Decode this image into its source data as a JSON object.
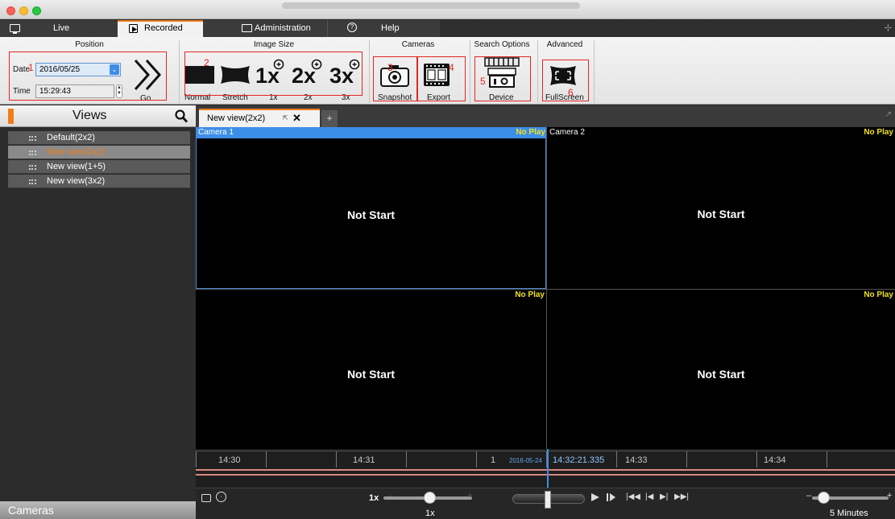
{
  "main_tabs": [
    {
      "label": "Live",
      "icon": "monitor-icon",
      "active": false
    },
    {
      "label": "Recorded",
      "icon": "play-icon",
      "active": true
    },
    {
      "label": "Administration",
      "icon": "window-icon",
      "active": false
    },
    {
      "label": "Help",
      "icon": "help-icon",
      "active": false
    }
  ],
  "ribbon": {
    "position": {
      "title": "Position",
      "date_label": "Date",
      "date_value": "2016/05/25",
      "time_label": "Time",
      "time_value": "15:29:43",
      "go_label": "Go"
    },
    "image_size": {
      "title": "Image Size",
      "buttons": [
        "Normal",
        "Stretch",
        "1x",
        "2x",
        "3x"
      ],
      "glyphs": [
        "1x",
        "2x",
        "3x"
      ]
    },
    "cameras": {
      "title": "Cameras",
      "buttons": [
        "Snapshot",
        "Export"
      ]
    },
    "search_options": {
      "title": "Search Options",
      "buttons": [
        "Device"
      ]
    },
    "advanced": {
      "title": "Advanced",
      "buttons": [
        "FullScreen"
      ]
    },
    "annotations": [
      "1",
      "2",
      "3",
      "4",
      "5",
      "6"
    ]
  },
  "views_panel": {
    "title": "Views",
    "items": [
      {
        "label": "Default(2x2)",
        "selected": false
      },
      {
        "label": "New view(2x2)",
        "selected": true
      },
      {
        "label": "New view(1+5)",
        "selected": false
      },
      {
        "label": "New view(3x2)",
        "selected": false
      }
    ]
  },
  "cameras_panel": {
    "title": "Cameras"
  },
  "view_tabs": [
    {
      "label": "New view(2x2)",
      "active": true
    }
  ],
  "cameras": [
    {
      "header": "Camera 1",
      "status": "No Play",
      "message": "Not Start",
      "selected": true
    },
    {
      "header": "Camera 2",
      "status": "No Play",
      "message": "Not Start",
      "selected": false
    },
    {
      "header": "",
      "status": "No Play",
      "message": "Not Start",
      "selected": false
    },
    {
      "header": "",
      "status": "No Play",
      "message": "Not Start",
      "selected": false
    }
  ],
  "timeline": {
    "ticks": [
      "14:30",
      "14:31",
      "14:33",
      "14:34"
    ],
    "marker_count": "1",
    "cursor_date": "2016-05-24",
    "cursor_time": "14:32:21.335"
  },
  "controls": {
    "speed_label": "1x",
    "speed_value": "1x",
    "zoom_value": "5 Minutes"
  },
  "colors": {
    "accent_orange": "#f07d1a",
    "selection_blue": "#2f8bde",
    "annotation_red": "#e42525",
    "status_yellow": "#f0e022"
  }
}
